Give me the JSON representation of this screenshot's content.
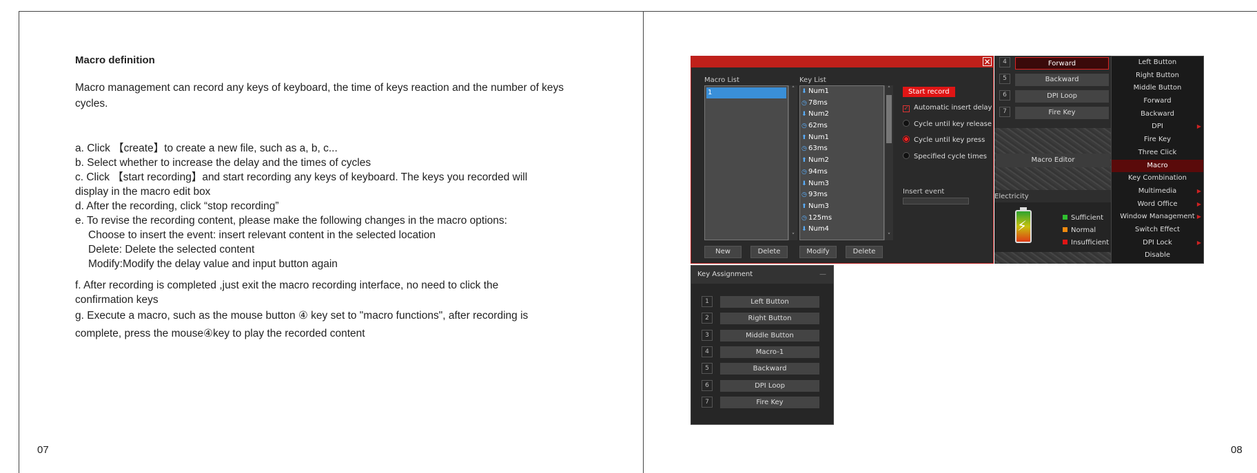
{
  "left_page": {
    "title": "Macro definition",
    "intro": "Macro management can record any keys of keyboard, the time of keys reaction and the number of keys cycles.",
    "steps": {
      "a": "a. Click 【create】to create a new file, such as a, b, c...",
      "b": "b. Select whether to increase the delay and the times of cycles",
      "c1": "c. Click 【start recording】and start recording any keys of keyboard. The keys you recorded will",
      "c2": "display in the macro edit box",
      "d": "d. After the recording, click “stop recording”",
      "e": "e. To revise the recording content, please make the following changes in the macro options:",
      "e1": "Choose to insert the event: insert relevant content in the selected location",
      "e2": "Delete: Delete the selected content",
      "e3": "Modify:Modify the delay value and input button again",
      "f1": "f. After recording is completed ,just exit the macro recording interface, no need to click the",
      "f2": "confirmation keys",
      "g1": "g. Execute a macro, such as the mouse button ④ key set to \"macro functions\", after recording is",
      "g2": "complete, press the mouse④key to play the recorded content"
    },
    "page_number": "07"
  },
  "right_page": {
    "page_number": "08"
  },
  "macro_window": {
    "close": "✕",
    "macro_list_label": "Macro List",
    "key_list_label": "Key List",
    "macro_items": [
      "1"
    ],
    "key_items": [
      {
        "icon": "down-arrow",
        "text": "Num1"
      },
      {
        "icon": "clock",
        "text": "78ms"
      },
      {
        "icon": "down-arrow",
        "text": "Num2"
      },
      {
        "icon": "clock",
        "text": "62ms"
      },
      {
        "icon": "up-arrow",
        "text": "Num1"
      },
      {
        "icon": "clock",
        "text": "63ms"
      },
      {
        "icon": "up-arrow",
        "text": "Num2"
      },
      {
        "icon": "clock",
        "text": "94ms"
      },
      {
        "icon": "down-arrow",
        "text": "Num3"
      },
      {
        "icon": "clock",
        "text": "93ms"
      },
      {
        "icon": "up-arrow",
        "text": "Num3"
      },
      {
        "icon": "clock",
        "text": "125ms"
      },
      {
        "icon": "down-arrow",
        "text": "Num4"
      }
    ],
    "start_record": "Start record",
    "options": {
      "auto_delay": "Automatic insert delay",
      "cycle_release": "Cycle until key release",
      "cycle_press": "Cycle until key press",
      "specified": "Specified cycle times"
    },
    "insert_event": "Insert event",
    "buttons": {
      "new": "New",
      "delete1": "Delete",
      "modify": "Modify",
      "delete2": "Delete"
    },
    "accent_color": "#c0201a"
  },
  "side_panel": {
    "rows": [
      {
        "num": "4",
        "label": "Forward"
      },
      {
        "num": "5",
        "label": "Backward"
      },
      {
        "num": "6",
        "label": "DPI Loop"
      },
      {
        "num": "7",
        "label": "Fire Key"
      }
    ],
    "macro_editor": "Macro Editor",
    "electricity": "Electricity",
    "legend": [
      {
        "label": "Sufficient",
        "color": "#2fbf2f"
      },
      {
        "label": "Normal",
        "color": "#f08a10"
      },
      {
        "label": "Insufficient",
        "color": "#e01515"
      }
    ]
  },
  "function_menu": {
    "items": [
      {
        "label": "Left Button",
        "sub": ""
      },
      {
        "label": "Right Button",
        "sub": ""
      },
      {
        "label": "Middle Button",
        "sub": ""
      },
      {
        "label": "Forward",
        "sub": ""
      },
      {
        "label": "Backward",
        "sub": ""
      },
      {
        "label": "DPI",
        "sub": "▶"
      },
      {
        "label": "Fire Key",
        "sub": ""
      },
      {
        "label": "Three Click",
        "sub": ""
      },
      {
        "label": "Macro",
        "sub": ""
      },
      {
        "label": "Key Combination",
        "sub": ""
      },
      {
        "label": "Multimedia",
        "sub": "▶"
      },
      {
        "label": "Word Office",
        "sub": "▶"
      },
      {
        "label": "Window Management",
        "sub": "▶"
      },
      {
        "label": "Switch Effect",
        "sub": ""
      },
      {
        "label": "DPI Lock",
        "sub": "▶"
      },
      {
        "label": "Disable",
        "sub": ""
      }
    ],
    "selected": "Macro"
  },
  "key_assignment": {
    "title": "Key Assignment",
    "minimize": "—",
    "rows": [
      {
        "num": "1",
        "label": "Left Button"
      },
      {
        "num": "2",
        "label": "Right Button"
      },
      {
        "num": "3",
        "label": "Middle Button"
      },
      {
        "num": "4",
        "label": "Macro-1"
      },
      {
        "num": "5",
        "label": "Backward"
      },
      {
        "num": "6",
        "label": "DPI Loop"
      },
      {
        "num": "7",
        "label": "Fire Key"
      }
    ]
  }
}
